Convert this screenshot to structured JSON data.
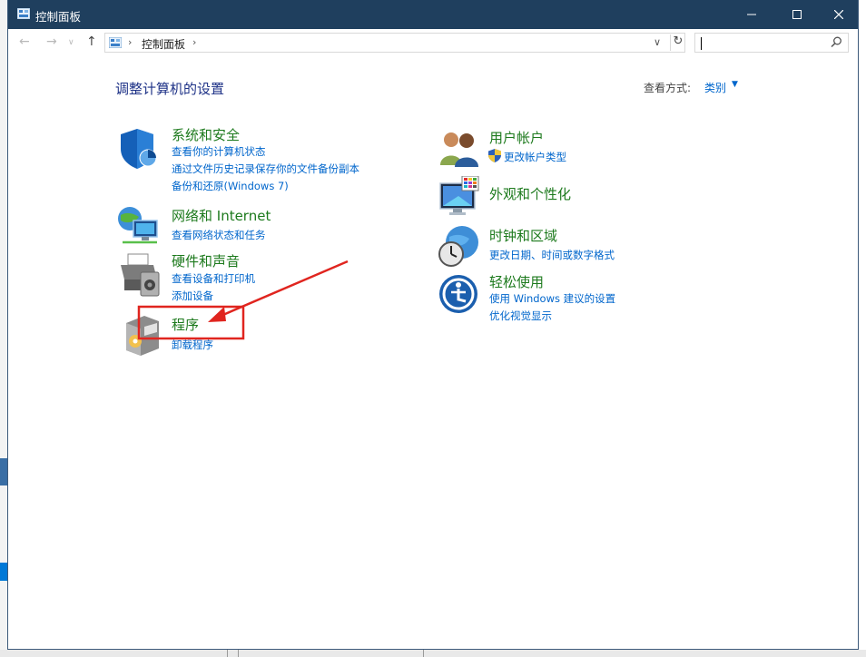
{
  "window": {
    "title": "控制面板"
  },
  "address": {
    "crumb": "控制面板",
    "search_placeholder": ""
  },
  "main": {
    "heading": "调整计算机的设置",
    "view_by_label": "查看方式:",
    "view_by_value": "类别"
  },
  "left_categories": [
    {
      "title": "系统和安全",
      "links": [
        "查看你的计算机状态",
        "通过文件历史记录保存你的文件备份副本",
        "备份和还原(Windows 7)"
      ],
      "icon": "shield-icon"
    },
    {
      "title": "网络和 Internet",
      "links": [
        "查看网络状态和任务"
      ],
      "icon": "network-icon"
    },
    {
      "title": "硬件和声音",
      "links": [
        "查看设备和打印机",
        "添加设备"
      ],
      "icon": "printer-icon"
    },
    {
      "title": "程序",
      "links": [
        "卸载程序"
      ],
      "icon": "programs-icon"
    }
  ],
  "right_categories": [
    {
      "title": "用户帐户",
      "links": [
        "更改帐户类型"
      ],
      "icon": "users-icon"
    },
    {
      "title": "外观和个性化",
      "links": [],
      "icon": "monitor-icon"
    },
    {
      "title": "时钟和区域",
      "links": [
        "更改日期、时间或数字格式"
      ],
      "icon": "clock-globe-icon"
    },
    {
      "title": "轻松使用",
      "links": [
        "使用 Windows 建议的设置",
        "优化视觉显示"
      ],
      "icon": "ease-of-access-icon"
    }
  ],
  "colors": {
    "titlebar": "#1f3f5e",
    "link": "#0066cc",
    "category_title": "#1d7a1d",
    "heading": "#1e3287",
    "annotation": "#e0251f"
  }
}
